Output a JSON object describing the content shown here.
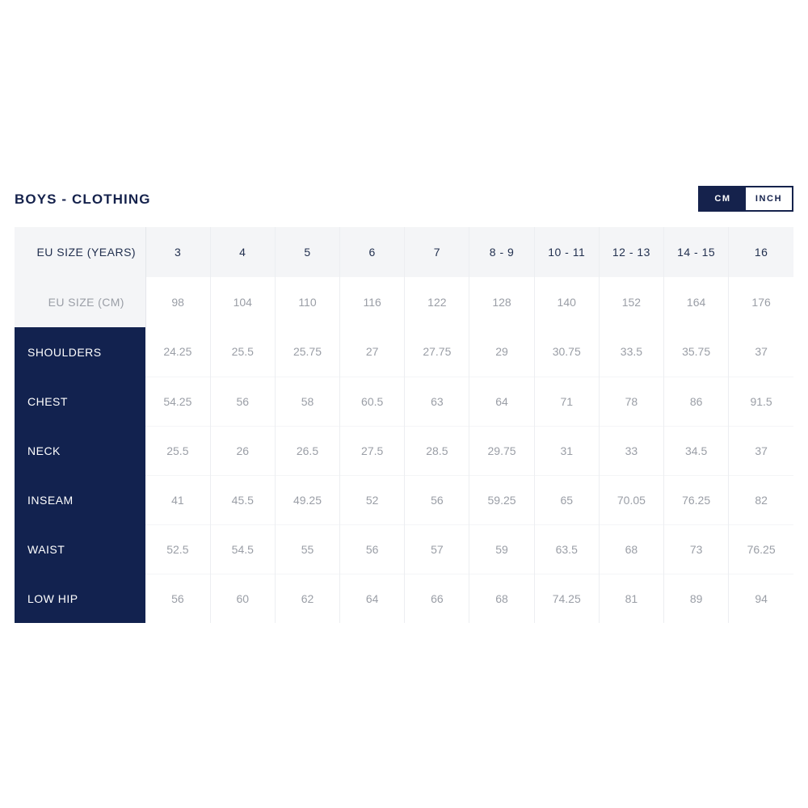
{
  "header": {
    "title": "BOYS - CLOTHING",
    "unit_toggle": {
      "name": "unit-toggle",
      "active_unit": "CM",
      "options": [
        {
          "label": "CM",
          "active": true
        },
        {
          "label": "INCH",
          "active": false
        }
      ],
      "cm_label": "CM",
      "inch_label": "INCH"
    }
  },
  "colors": {
    "navy": "#12224f",
    "title_navy": "#15224c",
    "header_bg": "#f4f5f7",
    "value_text": "#9a9ea6",
    "header_text": "#22304f",
    "divider": "#eceef1"
  },
  "chart_data": {
    "type": "table",
    "title": "BOYS - CLOTHING",
    "unit": "CM",
    "row_header_labels": [
      "EU SIZE (YEARS)",
      "EU SIZE (CM)"
    ],
    "columns": [
      "3",
      "4",
      "5",
      "6",
      "7",
      "8 - 9",
      "10 - 11",
      "12 - 13",
      "14 - 15",
      "16"
    ],
    "eu_size_cm": [
      "98",
      "104",
      "110",
      "116",
      "122",
      "128",
      "140",
      "152",
      "164",
      "176"
    ],
    "measurements": [
      {
        "label": "SHOULDERS",
        "values": [
          "24.25",
          "25.5",
          "25.75",
          "27",
          "27.75",
          "29",
          "30.75",
          "33.5",
          "35.75",
          "37"
        ]
      },
      {
        "label": "CHEST",
        "values": [
          "54.25",
          "56",
          "58",
          "60.5",
          "63",
          "64",
          "71",
          "78",
          "86",
          "91.5"
        ]
      },
      {
        "label": "NECK",
        "values": [
          "25.5",
          "26",
          "26.5",
          "27.5",
          "28.5",
          "29.75",
          "31",
          "33",
          "34.5",
          "37"
        ]
      },
      {
        "label": "INSEAM",
        "values": [
          "41",
          "45.5",
          "49.25",
          "52",
          "56",
          "59.25",
          "65",
          "70.05",
          "76.25",
          "82"
        ]
      },
      {
        "label": "WAIST",
        "values": [
          "52.5",
          "54.5",
          "55",
          "56",
          "57",
          "59",
          "63.5",
          "68",
          "73",
          "76.25"
        ]
      },
      {
        "label": "LOW HIP",
        "values": [
          "56",
          "60",
          "62",
          "64",
          "66",
          "68",
          "74.25",
          "81",
          "89",
          "94"
        ]
      }
    ]
  }
}
